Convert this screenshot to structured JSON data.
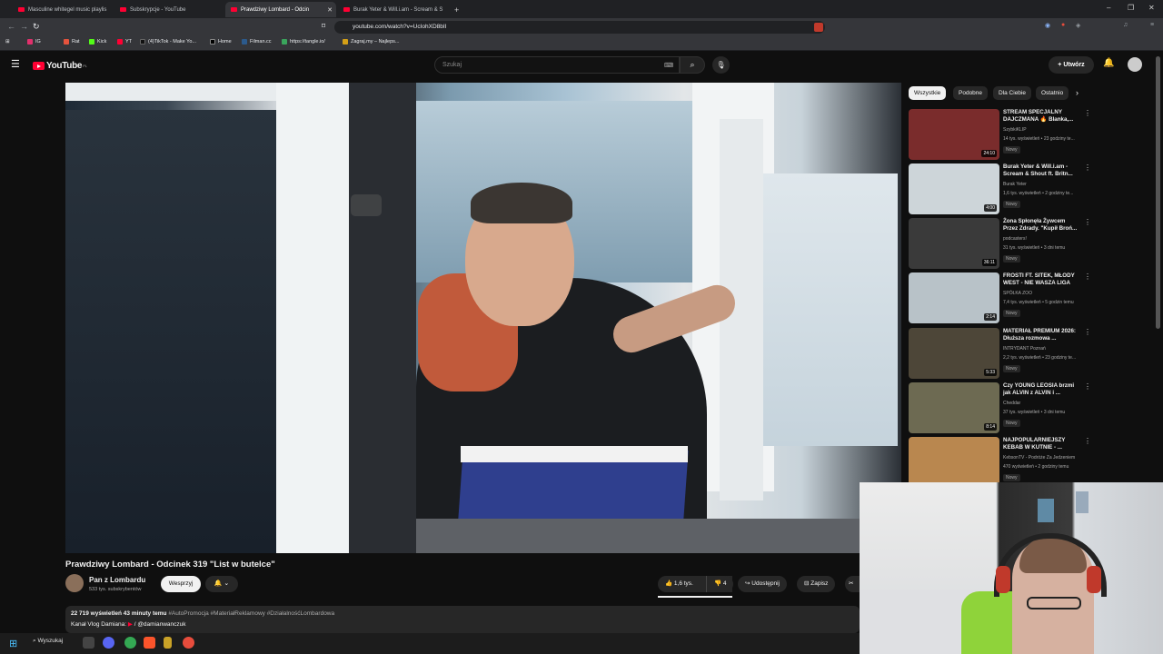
{
  "browser": {
    "tabs": [
      {
        "label": "Masculine whitegel music playlis"
      },
      {
        "label": "Subskrypcje - YouTube"
      },
      {
        "label": "Prawdziwy Lombard - Odcin"
      },
      {
        "label": "Burak Yeter & Will.i.am - Scream & S"
      }
    ],
    "new_tab": "+",
    "window_controls": [
      "–",
      "❐",
      "✕"
    ],
    "url": "youtube.com/watch?v=UcIohXD8bII",
    "bookmarks": [
      "IG",
      "Rat",
      "Kick",
      "YT",
      "(4)TikTok - Make Yo...",
      "Home",
      "Filman.cc",
      "https://tangle.io/",
      "Zagraj.my – Najleps..."
    ]
  },
  "header": {
    "logo_text": "YouTube",
    "logo_country": "PL",
    "search_placeholder": "Szukaj",
    "create_label": "Utwórz"
  },
  "video": {
    "title": "Prawdziwy Lombard - Odcinek 319 \"List w butelce\"",
    "channel": "Pan z Lombardu",
    "subscribers": "533 tys. subskrybentów",
    "support_label": "Wesprzyj",
    "likes": "1,6 tys.",
    "dislikes": "4",
    "share_label": "Udostępnij",
    "save_label": "Zapisz",
    "views_time": "22 719 wyświetleń  43 minuty temu",
    "hashtags": "#AutoPromocja #MateriałReklamowy #DziałalnośćLombardowa",
    "desc_line2_prefix": "Kanał Vlog Damiana:",
    "desc_line2_handle": "/ @damianwanczuk"
  },
  "chips": [
    {
      "label": "Wszystkie",
      "active": true
    },
    {
      "label": "Podobne",
      "active": false
    },
    {
      "label": "Dla Ciebie",
      "active": false
    },
    {
      "label": "Ostatnio",
      "active": false
    }
  ],
  "recommendations": [
    {
      "title": "STREAM SPECJALNY DAJCZMANA 🔥 Blanka,...",
      "channel": "SzybkiKLIP",
      "meta": "14 tys. wyświetleń • 23 godziny te...",
      "badge": "Nowy",
      "duration": "24:10",
      "thumb_color": "#7a2c2c"
    },
    {
      "title": "Burak Yeter & Will.i.am - Scream & Shout ft. Britn...",
      "channel": "Burak Yeter",
      "meta": "1,6 tys. wyświetleń • 2 godziny te...",
      "badge": "Nowy",
      "duration": "4:00",
      "thumb_color": "#cdd5d9"
    },
    {
      "title": "Żona Spłonęła Żywcem Przez Zdrady. \"Kupił Broń...",
      "channel": "podcasters!",
      "meta": "31 tys. wyświetleń • 3 dni temu",
      "badge": "Nowy",
      "duration": "36:11",
      "thumb_color": "#3a3a3a"
    },
    {
      "title": "FROSTI FT. SITEK, MŁODY WEST - NIE WASZA LIGA",
      "channel": "SPÓŁKA ZOO",
      "meta": "7,4 tys. wyświetleń • 5 godzin temu",
      "badge": "Nowy",
      "duration": "2:14",
      "thumb_color": "#b8c2c8"
    },
    {
      "title": "MATERIAŁ PREMIUM 2026: Dłuższa rozmowa ...",
      "channel": "INTRYDANT Poznań",
      "meta": "2,2 tys. wyświetleń • 23 godziny te...",
      "badge": "Nowy",
      "duration": "5:33",
      "thumb_color": "#4d4638"
    },
    {
      "title": "Czy YOUNG LEOSIA brzmi jak ALVIN z ALVIN i ...",
      "channel": "Cheddar",
      "meta": "37 tys. wyświetleń • 3 dni temu",
      "badge": "Nowy",
      "duration": "8:14",
      "thumb_color": "#6d6a52"
    },
    {
      "title": "NAJPOPULARNIEJSZY KEBAB W KUTNIE - ...",
      "channel": "KebsonTV - Podróże Za Jedzeniem",
      "meta": "470 wyświetleń • 2 godziny temu",
      "badge": "Nowy",
      "duration": "",
      "thumb_color": "#b9874f"
    }
  ],
  "taskbar": {
    "search_label": "Wyszukaj"
  },
  "colors": {
    "youtube_red": "#ff0033",
    "background": "#0f0f0f"
  }
}
